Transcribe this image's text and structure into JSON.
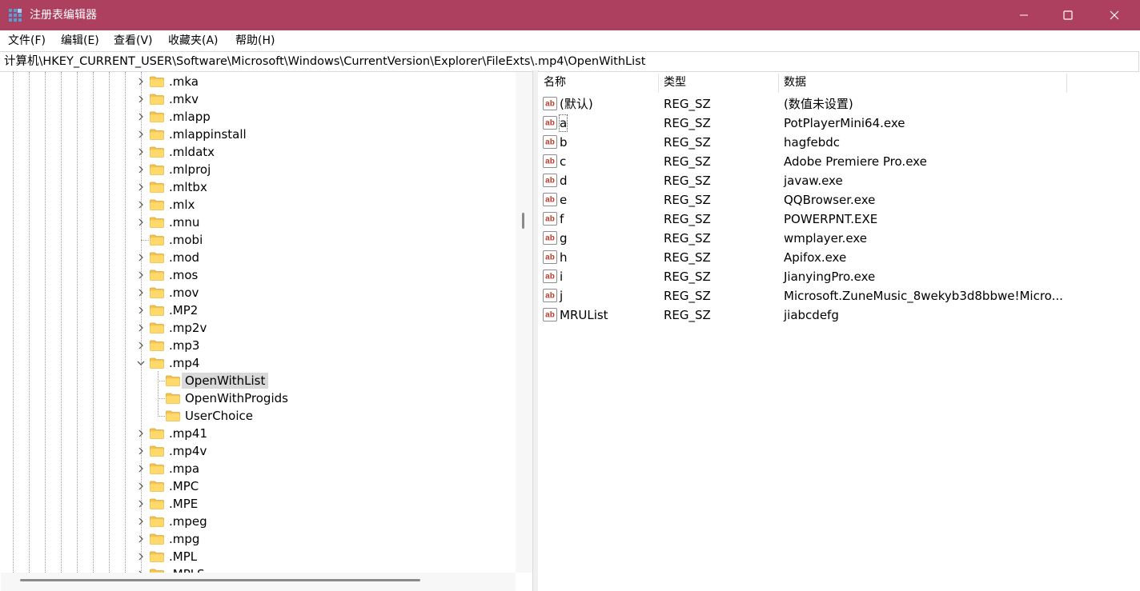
{
  "window": {
    "title": "注册表编辑器"
  },
  "menu": [
    "文件(F)",
    "编辑(E)",
    "查看(V)",
    "收藏夹(A)",
    "帮助(H)"
  ],
  "address": "计算机\\HKEY_CURRENT_USER\\Software\\Microsoft\\Windows\\CurrentVersion\\Explorer\\FileExts\\.mp4\\OpenWithList",
  "tree": [
    {
      "label": ".mka",
      "expand": "collapsed",
      "level": 0
    },
    {
      "label": ".mkv",
      "expand": "collapsed",
      "level": 0
    },
    {
      "label": ".mlapp",
      "expand": "collapsed",
      "level": 0
    },
    {
      "label": ".mlappinstall",
      "expand": "collapsed",
      "level": 0
    },
    {
      "label": ".mldatx",
      "expand": "collapsed",
      "level": 0
    },
    {
      "label": ".mlproj",
      "expand": "collapsed",
      "level": 0
    },
    {
      "label": ".mltbx",
      "expand": "collapsed",
      "level": 0
    },
    {
      "label": ".mlx",
      "expand": "collapsed",
      "level": 0
    },
    {
      "label": ".mnu",
      "expand": "collapsed",
      "level": 0
    },
    {
      "label": ".mobi",
      "expand": "leaf",
      "level": 0
    },
    {
      "label": ".mod",
      "expand": "collapsed",
      "level": 0
    },
    {
      "label": ".mos",
      "expand": "collapsed",
      "level": 0
    },
    {
      "label": ".mov",
      "expand": "collapsed",
      "level": 0
    },
    {
      "label": ".MP2",
      "expand": "collapsed",
      "level": 0
    },
    {
      "label": ".mp2v",
      "expand": "collapsed",
      "level": 0
    },
    {
      "label": ".mp3",
      "expand": "collapsed",
      "level": 0
    },
    {
      "label": ".mp4",
      "expand": "expanded",
      "level": 0
    },
    {
      "label": "OpenWithList",
      "expand": "leaf",
      "level": 1,
      "selected": true
    },
    {
      "label": "OpenWithProgids",
      "expand": "leaf",
      "level": 1
    },
    {
      "label": "UserChoice",
      "expand": "leaf",
      "level": 1
    },
    {
      "label": ".mp41",
      "expand": "collapsed",
      "level": 0
    },
    {
      "label": ".mp4v",
      "expand": "collapsed",
      "level": 0
    },
    {
      "label": ".mpa",
      "expand": "collapsed",
      "level": 0
    },
    {
      "label": ".MPC",
      "expand": "collapsed",
      "level": 0
    },
    {
      "label": ".MPE",
      "expand": "collapsed",
      "level": 0
    },
    {
      "label": ".mpeg",
      "expand": "collapsed",
      "level": 0
    },
    {
      "label": ".mpg",
      "expand": "collapsed",
      "level": 0
    },
    {
      "label": ".MPL",
      "expand": "collapsed",
      "level": 0
    },
    {
      "label": ".MPLS",
      "expand": "collapsed",
      "level": 0
    }
  ],
  "columns": {
    "name": "名称",
    "type": "类型",
    "data": "数据"
  },
  "values": [
    {
      "name": "(默认)",
      "type": "REG_SZ",
      "data": "(数值未设置)"
    },
    {
      "name": "a",
      "type": "REG_SZ",
      "data": "PotPlayerMini64.exe",
      "focused": true
    },
    {
      "name": "b",
      "type": "REG_SZ",
      "data": "hagfebdc"
    },
    {
      "name": "c",
      "type": "REG_SZ",
      "data": "Adobe Premiere Pro.exe"
    },
    {
      "name": "d",
      "type": "REG_SZ",
      "data": "javaw.exe"
    },
    {
      "name": "e",
      "type": "REG_SZ",
      "data": "QQBrowser.exe"
    },
    {
      "name": "f",
      "type": "REG_SZ",
      "data": "POWERPNT.EXE"
    },
    {
      "name": "g",
      "type": "REG_SZ",
      "data": "wmplayer.exe"
    },
    {
      "name": "h",
      "type": "REG_SZ",
      "data": "Apifox.exe"
    },
    {
      "name": "i",
      "type": "REG_SZ",
      "data": "JianyingPro.exe"
    },
    {
      "name": "j",
      "type": "REG_SZ",
      "data": "Microsoft.ZuneMusic_8wekyb3d8bbwe!Micro..."
    },
    {
      "name": "MRUList",
      "type": "REG_SZ",
      "data": "jiabcdefg"
    }
  ],
  "icons": {
    "app": "registry-editor-icon",
    "tree_node": "folder-icon",
    "value": "string-value-icon",
    "expand": "chevron-right-icon",
    "collapse": "chevron-down-icon"
  },
  "colors": {
    "titlebar": "#ad3f5f",
    "folder": "#f5c44e",
    "string_icon": "#c0392b"
  }
}
